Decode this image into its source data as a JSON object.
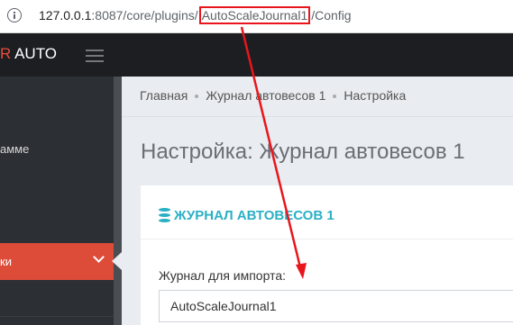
{
  "browser": {
    "url_host": "127.0.0.1",
    "url_port_path": ":8087/core/plugins/",
    "url_highlight": "AutoScaleJournal1",
    "url_tail": "/Config"
  },
  "app": {
    "logo_red": "R",
    "logo_text": "AUTO"
  },
  "sidebar": {
    "item_1": "амме",
    "item_active": "ки"
  },
  "breadcrumb": {
    "home": "Главная",
    "journal": "Журнал автовесов 1",
    "current": "Настройка"
  },
  "page": {
    "title": "Настройка: Журнал автовесов 1"
  },
  "card": {
    "title": "ЖУРНАЛ АВТОВЕСОВ 1",
    "field_label": "Журнал для импорта:",
    "field_value": "AutoScaleJournal1"
  },
  "colors": {
    "accent": "#2ab0c5",
    "active": "#dd4b39",
    "annotation": "#e8161c"
  }
}
